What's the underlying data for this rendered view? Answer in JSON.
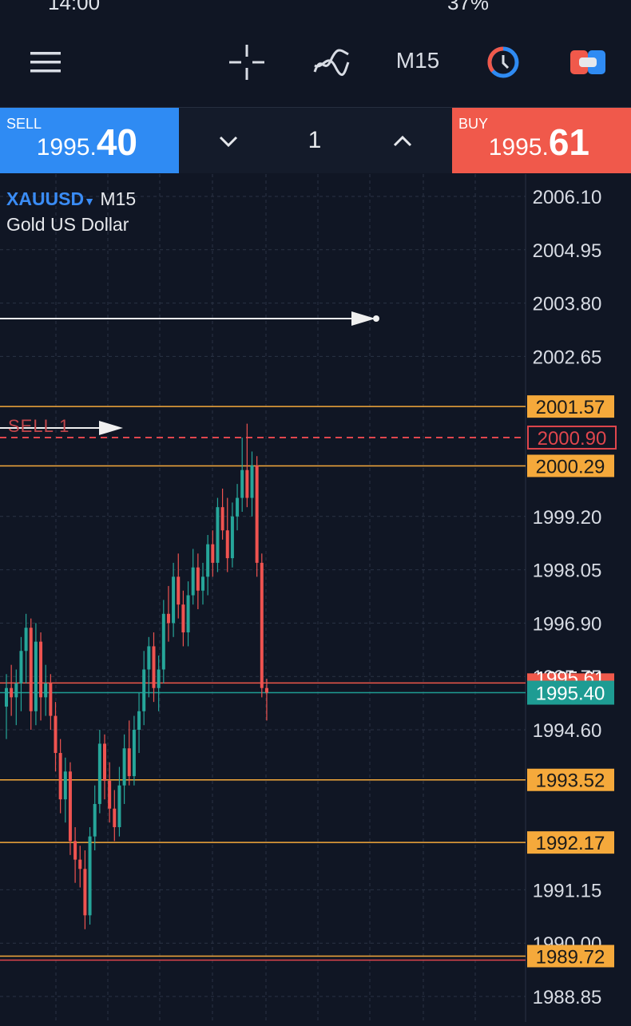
{
  "status": {
    "time": "14:00",
    "battery": "37%"
  },
  "toolbar": {
    "menu_icon": "hamburger-menu-icon",
    "crosshair_icon": "crosshair-icon",
    "indicators_icon": "indicators-icon",
    "timeframe": "M15",
    "timer_icon": "clock-timer-icon",
    "trade_icon": "trade-toggle-icon"
  },
  "trade_panel": {
    "sell_label": "SELL",
    "sell_price_small": "1995.",
    "sell_price_big": "40",
    "quantity": "1",
    "buy_label": "BUY",
    "buy_price_small": "1995.",
    "buy_price_big": "61"
  },
  "chart": {
    "symbol": "XAUUSD",
    "timeframe": "M15",
    "description": "Gold US Dollar",
    "sell_order_label": "SELL 1",
    "colors": {
      "bull": "#26a69a",
      "bear": "#ef5350",
      "level": "#f5a93b",
      "order": "#e0464d",
      "bid": "#1e9c93"
    }
  },
  "chart_data": {
    "type": "candlestick",
    "symbol": "XAUUSD",
    "timeframe": "M15",
    "ylim": [
      1988.3,
      2006.8
    ],
    "y_ticks": [
      "2006.10",
      "2004.95",
      "2003.80",
      "2002.65",
      "1999.20",
      "1998.05",
      "1996.90",
      "1995.75",
      "1994.60",
      "1991.15",
      "1990.00",
      "1988.85"
    ],
    "levels": [
      {
        "value": 2001.57,
        "label": "2001.57"
      },
      {
        "value": 2000.29,
        "label": "2000.29"
      },
      {
        "value": 1993.52,
        "label": "1993.52"
      },
      {
        "value": 1992.17,
        "label": "1992.17"
      },
      {
        "value": 1989.72,
        "label": "1989.72"
      }
    ],
    "order_line": {
      "value": 2000.9,
      "label": "2000.90"
    },
    "ask_line": {
      "value": 1995.61,
      "label": "1995.61"
    },
    "bid_line": {
      "value": 1995.4,
      "label": "1995.40"
    },
    "candles": [
      [
        1995.1,
        1995.8,
        1994.4,
        1995.5
      ],
      [
        1995.5,
        1996.0,
        1994.9,
        1995.3
      ],
      [
        1995.3,
        1995.9,
        1994.7,
        1995.6
      ],
      [
        1995.6,
        1996.6,
        1995.0,
        1996.3
      ],
      [
        1996.3,
        1997.1,
        1995.6,
        1996.8
      ],
      [
        1996.8,
        1997.0,
        1994.6,
        1995.0
      ],
      [
        1995.0,
        1996.9,
        1994.7,
        1996.5
      ],
      [
        1996.5,
        1996.7,
        1994.8,
        1995.3
      ],
      [
        1995.3,
        1996.0,
        1994.9,
        1995.6
      ],
      [
        1995.6,
        1995.8,
        1994.6,
        1994.9
      ],
      [
        1994.9,
        1995.2,
        1993.7,
        1994.1
      ],
      [
        1994.1,
        1994.4,
        1992.8,
        1993.1
      ],
      [
        1993.1,
        1994.0,
        1992.6,
        1993.7
      ],
      [
        1993.7,
        1993.9,
        1991.9,
        1992.2
      ],
      [
        1992.2,
        1992.5,
        1991.3,
        1991.8
      ],
      [
        1991.8,
        1992.1,
        1991.2,
        1991.6
      ],
      [
        1991.6,
        1992.0,
        1990.3,
        1990.6
      ],
      [
        1990.6,
        1992.5,
        1990.4,
        1992.3
      ],
      [
        1992.3,
        1993.4,
        1992.0,
        1993.0
      ],
      [
        1993.0,
        1994.6,
        1992.8,
        1994.3
      ],
      [
        1994.3,
        1994.5,
        1993.1,
        1993.5
      ],
      [
        1993.5,
        1993.9,
        1992.6,
        1992.9
      ],
      [
        1992.9,
        1993.3,
        1992.2,
        1992.5
      ],
      [
        1992.5,
        1993.8,
        1992.3,
        1993.4
      ],
      [
        1993.4,
        1994.5,
        1993.0,
        1994.2
      ],
      [
        1994.2,
        1994.8,
        1993.4,
        1993.6
      ],
      [
        1993.6,
        1994.9,
        1993.4,
        1994.6
      ],
      [
        1994.6,
        1995.4,
        1994.1,
        1995.0
      ],
      [
        1995.0,
        1996.3,
        1994.7,
        1995.9
      ],
      [
        1995.9,
        1996.6,
        1995.3,
        1996.4
      ],
      [
        1996.4,
        1996.7,
        1995.2,
        1995.5
      ],
      [
        1995.5,
        1996.2,
        1995.0,
        1995.9
      ],
      [
        1995.9,
        1997.4,
        1995.6,
        1997.1
      ],
      [
        1997.1,
        1997.7,
        1996.5,
        1996.9
      ],
      [
        1996.9,
        1998.2,
        1996.6,
        1997.9
      ],
      [
        1997.9,
        1998.4,
        1997.0,
        1997.3
      ],
      [
        1997.3,
        1997.6,
        1996.4,
        1996.7
      ],
      [
        1996.7,
        1997.8,
        1996.4,
        1997.5
      ],
      [
        1997.5,
        1998.5,
        1997.3,
        1998.1
      ],
      [
        1998.1,
        1998.4,
        1997.2,
        1997.6
      ],
      [
        1997.6,
        1998.2,
        1997.3,
        1997.9
      ],
      [
        1997.9,
        1998.8,
        1997.5,
        1998.6
      ],
      [
        1998.6,
        1998.9,
        1997.9,
        1998.2
      ],
      [
        1998.2,
        1999.6,
        1998.0,
        1999.4
      ],
      [
        1999.4,
        1999.8,
        1998.7,
        1998.9
      ],
      [
        1998.9,
        1999.6,
        1998.0,
        1998.3
      ],
      [
        1998.3,
        1999.5,
        1998.1,
        1999.2
      ],
      [
        1999.2,
        1999.9,
        1998.9,
        1999.6
      ],
      [
        1999.6,
        2000.9,
        1999.3,
        2000.2
      ],
      [
        2000.2,
        2001.2,
        1999.4,
        1999.6
      ],
      [
        1999.6,
        2000.6,
        1999.2,
        2000.3
      ],
      [
        2000.3,
        2000.5,
        1997.9,
        1998.2
      ],
      [
        1998.2,
        1998.4,
        1995.3,
        1995.5
      ],
      [
        1995.5,
        1995.7,
        1994.8,
        1995.4
      ]
    ]
  }
}
